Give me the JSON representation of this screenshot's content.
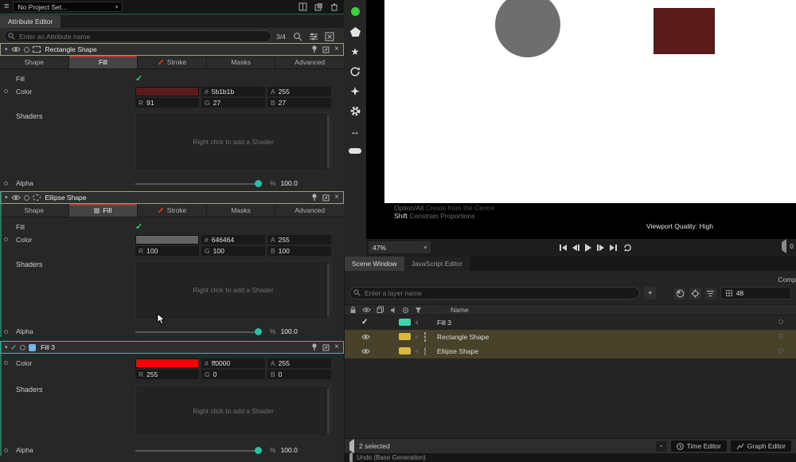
{
  "colors": {
    "record_green": "#3bd13b",
    "accent_teal": "#2bbfa4",
    "layer_teal": "#3fd2b1",
    "layer_yellow": "#d9b944",
    "layer_blue": "#7ab8e8",
    "viewport_circle": "#6e6e6e",
    "viewport_square": "#5b1b1b"
  },
  "top_bar": {
    "project_dropdown": "No Project Set..."
  },
  "attribute_editor": {
    "panel_tab": "Attribute Editor",
    "search_placeholder": "Enter an Attribute name",
    "match_counter": "3/4",
    "shader_hint": "Right click to add a Shader",
    "labels": {
      "fill": "Fill",
      "color": "Color",
      "shaders": "Shaders",
      "alpha": "Alpha",
      "percent": "%",
      "hex_prefix": "#",
      "a": "A",
      "r": "R",
      "g": "G",
      "b": "B"
    },
    "tabs": [
      "Shape",
      "Fill",
      "Stroke",
      "Masks",
      "Advanced"
    ],
    "sections": [
      {
        "title": "Rectangle Shape",
        "swatch_color": "#5b1b1b",
        "hex": "5b1b1b",
        "a": "255",
        "r": "91",
        "g": "27",
        "b": "27",
        "alpha": "100.0"
      },
      {
        "title": "Ellipse Shape",
        "swatch_color": "#646464",
        "hex": "646464",
        "a": "255",
        "r": "100",
        "g": "100",
        "b": "100",
        "alpha": "100.0"
      },
      {
        "title": "Fill 3",
        "swatch_color": "#ff0000",
        "hex": "ff0000",
        "a": "255",
        "r": "255",
        "g": "0",
        "b": "0",
        "alpha": "100.0"
      }
    ]
  },
  "viewport": {
    "hints": [
      {
        "key": "Option/Alt",
        "text": "Create from the Centre"
      },
      {
        "key": "Shift",
        "text": "Constrain Proportions"
      }
    ],
    "quality": "Viewport Quality: High",
    "zoom_level": "47%",
    "frame_counter": "0"
  },
  "scene_window": {
    "tabs": [
      "Scene Window",
      "JavaScript Editor"
    ],
    "comp_label": "Comp",
    "search_placeholder": "Enter a layer name",
    "add_button": "+",
    "value_field": "48",
    "name_header": "Name",
    "rows": [
      {
        "label": "Fill 3",
        "swatch_color": "#3fd2b1"
      },
      {
        "label": "Rectangle Shape",
        "swatch_color": "#d9b944"
      },
      {
        "label": "Ellipse Shape",
        "swatch_color": "#d9b944"
      }
    ],
    "footer": {
      "selection_count": "2 selected",
      "time_editor": "Time Editor",
      "graph_editor": "Graph Editor"
    },
    "status_message": "Undo (Base Generation)"
  }
}
